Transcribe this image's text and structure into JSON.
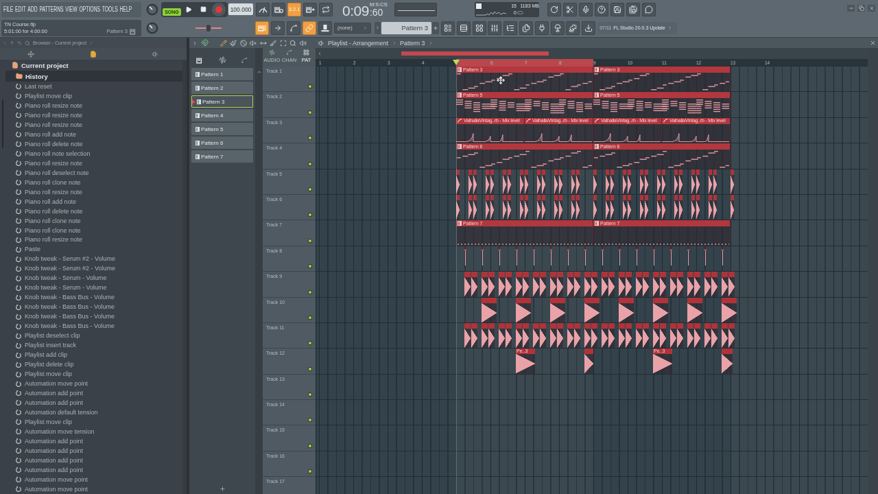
{
  "menu": [
    "FILE",
    "EDIT",
    "ADD",
    "PATTERNS",
    "VIEW",
    "OPTIONS",
    "TOOLS",
    "HELP"
  ],
  "hint_panel": {
    "project": "TN Course.flp",
    "length": "5:01:00 for 4:00:00",
    "pattern": "Pattern 3"
  },
  "transport": {
    "mode": "SONG",
    "song_mode": true,
    "tempo": "100.000"
  },
  "record_tools": [
    {
      "kind": "metronome",
      "on": false
    },
    {
      "kind": "wait",
      "on": false
    },
    {
      "kind": "countdown",
      "label": "3.2.1",
      "on": true
    },
    {
      "kind": "step",
      "on": false
    },
    {
      "kind": "loop",
      "on": false
    }
  ],
  "time": {
    "main": "0:09",
    "sub": ":60",
    "unit": "M:S:CS"
  },
  "monitor": {
    "cpu": "15",
    "memory": "1183 MB",
    "polyphony": "0"
  },
  "edit_tools": [
    {
      "kind": "typing",
      "on": true
    },
    {
      "kind": "arrow",
      "on": false
    },
    {
      "kind": "blend",
      "on": false
    },
    {
      "kind": "link",
      "on": true
    },
    {
      "kind": "hat",
      "on": false
    }
  ],
  "slider": {
    "level": 0.5
  },
  "selector": {
    "value": "(none)"
  },
  "pattern_selector": {
    "value": "Pattern 3"
  },
  "news": {
    "date": "07/11",
    "text": "FL Studio 20.0.3 Update"
  },
  "browser": {
    "path": "Browser - Current project",
    "root": "Current project",
    "folder": {
      "label": "History",
      "selected": true
    },
    "items": [
      "Last reset",
      "Playlist move clip",
      "Piano roll resize note",
      "Piano roll resize note",
      "Piano roll resize note",
      "Piano roll add note",
      "Piano roll delete note",
      "Piano roll note selection",
      "Piano roll resize note",
      "Piano roll deselect note",
      "Piano roll clone note",
      "Piano roll resize note",
      "Piano roll add note",
      "Piano roll delete note",
      "Piano roll clone note",
      "Piano roll clone note",
      "Piano roll resize note",
      "Paste",
      "Knob tweak - Serum #2 - Volume",
      "Knob tweak - Serum #2 - Volume",
      "Knob tweak - Serum - Volume",
      "Knob tweak - Serum - Volume",
      "Knob tweak - Bass Bus - Volume",
      "Knob tweak - Bass Bus - Volume",
      "Knob tweak - Bass Bus - Volume",
      "Knob tweak - Bass Bus - Volume",
      "Playlist deselect clip",
      "Playlist insert track",
      "Playlist add clip",
      "Playlist delete clip",
      "Playlist move clip",
      "Automation move point",
      "Automation add point",
      "Automation add point",
      "Automation default tension",
      "Playlist move clip",
      "Automation move tension",
      "Automation add point",
      "Automation add point",
      "Automation add point",
      "Automation add point",
      "Automation move point",
      "Automation move point"
    ]
  },
  "playlist": {
    "title": "Playlist - Arrangement",
    "pattern": "Pattern 3",
    "tools": [
      {
        "kind": "draw",
        "selected": true
      },
      {
        "kind": "paint",
        "selected": false
      },
      {
        "kind": "delete",
        "selected": false
      },
      {
        "kind": "mute",
        "selected": false
      },
      {
        "kind": "slip",
        "selected": false
      },
      {
        "kind": "slice",
        "selected": false
      },
      {
        "kind": "select",
        "selected": false
      },
      {
        "kind": "zoom",
        "selected": false
      },
      {
        "kind": "playback",
        "selected": false
      }
    ],
    "patterns": [
      {
        "label": "Pattern 1",
        "selected": false
      },
      {
        "label": "Pattern 2",
        "selected": false
      },
      {
        "label": "Pattern 3",
        "selected": true
      },
      {
        "label": "Pattern 4",
        "selected": false
      },
      {
        "label": "Pattern 5",
        "selected": false
      },
      {
        "label": "Pattern 6",
        "selected": false
      },
      {
        "label": "Pattern 7",
        "selected": false
      }
    ],
    "filters": [
      {
        "kind": "audio",
        "label": "AUDIO",
        "selected": false
      },
      {
        "kind": "automation",
        "label": "CHAN",
        "selected": false
      },
      {
        "kind": "pattern",
        "label": "PAT",
        "selected": true
      }
    ],
    "ruler": [
      "1",
      "2",
      "3",
      "4",
      "6",
      "7",
      "8",
      "9",
      "10",
      "11",
      "12",
      "13",
      "14"
    ],
    "tracks": [
      {
        "label": "Track 1",
        "kind": "pattern",
        "clips": [
          {
            "label": "Pattern 3"
          },
          {
            "label": "Pattern 3"
          }
        ]
      },
      {
        "label": "Track 2",
        "kind": "pattern",
        "clips": [
          {
            "label": "Pattern 5"
          },
          {
            "label": "Pattern 5"
          }
        ]
      },
      {
        "label": "Track 3",
        "kind": "automation",
        "clips": [
          {
            "label": "ValhallaVintag..rb - Mix level"
          },
          {
            "label": "ValhallaVintag..rb - Mix level"
          },
          {
            "label": "ValhallaVintag..rb - Mix level"
          },
          {
            "label": "ValhallaVintag..rb - Mix level"
          }
        ]
      },
      {
        "label": "Track 4",
        "kind": "pattern",
        "clips": [
          {
            "label": "Pattern 6"
          },
          {
            "label": "Pattern 6"
          }
        ]
      },
      {
        "label": "Track 5",
        "kind": "audio"
      },
      {
        "label": "Track 6",
        "kind": "audio"
      },
      {
        "label": "Track 7",
        "kind": "pattern",
        "clips": [
          {
            "label": "Pattern 7"
          },
          {
            "label": "Pattern 7"
          }
        ]
      },
      {
        "label": "Track 8",
        "kind": "audio"
      },
      {
        "label": "Track 9",
        "kind": "audio"
      },
      {
        "label": "Track 10",
        "kind": "audio"
      },
      {
        "label": "Track 11",
        "kind": "audio"
      },
      {
        "label": "Track 12",
        "kind": "audio",
        "clips": [
          {
            "label": "Pe..3"
          },
          {
            "label": "Pe..3"
          }
        ]
      },
      {
        "label": "Track 13",
        "kind": "empty"
      },
      {
        "label": "Track 14",
        "kind": "empty"
      },
      {
        "label": "Track 15",
        "kind": "empty"
      },
      {
        "label": "Track 16",
        "kind": "empty"
      },
      {
        "label": "Track 17",
        "kind": "empty"
      }
    ]
  }
}
